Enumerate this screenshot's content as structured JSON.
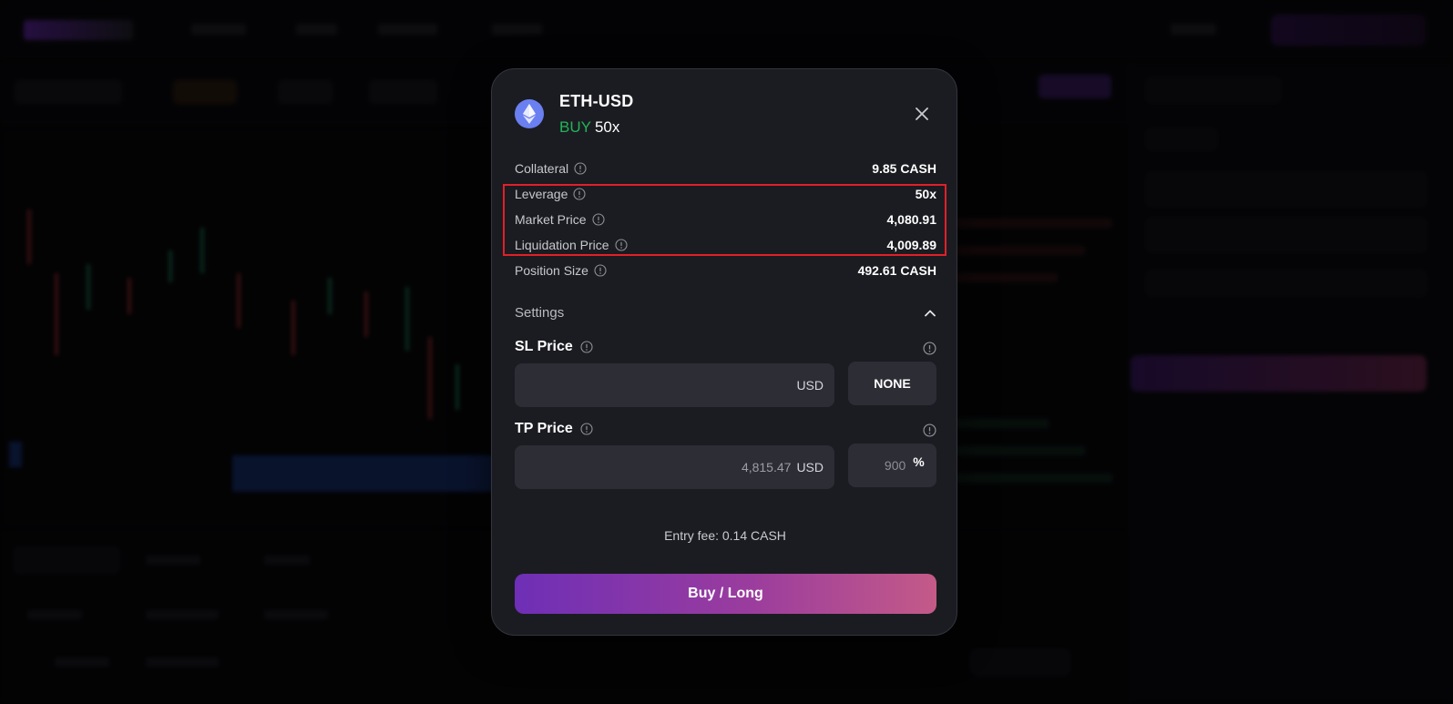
{
  "modal": {
    "asset": "ETH-USD",
    "side": "BUY",
    "leverage_label": "50x",
    "rows": [
      {
        "label": "Collateral",
        "value": "9.85 CASH"
      },
      {
        "label": "Leverage",
        "value": "50x"
      },
      {
        "label": "Market Price",
        "value": "4,080.91"
      },
      {
        "label": "Liquidation Price",
        "value": "4,009.89"
      },
      {
        "label": "Position Size",
        "value": "492.61 CASH"
      }
    ],
    "settings_label": "Settings",
    "sl": {
      "title": "SL Price",
      "value": "",
      "currency": "USD",
      "option": "NONE"
    },
    "tp": {
      "title": "TP Price",
      "value": "4,815.47",
      "currency": "USD",
      "percent": "900",
      "percent_symbol": "%"
    },
    "entry_fee": "Entry fee: 0.14 CASH",
    "submit_label": "Buy / Long"
  },
  "colors": {
    "buy": "#22b35a",
    "highlight": "#e0202a",
    "cta_start": "#6e2fb6",
    "cta_end": "#c45a88",
    "eth_icon": "#6a7ff0"
  },
  "icons": {
    "asset": "ethereum-icon",
    "close": "close-icon",
    "info": "info-icon",
    "collapse": "chevron-up-icon"
  }
}
